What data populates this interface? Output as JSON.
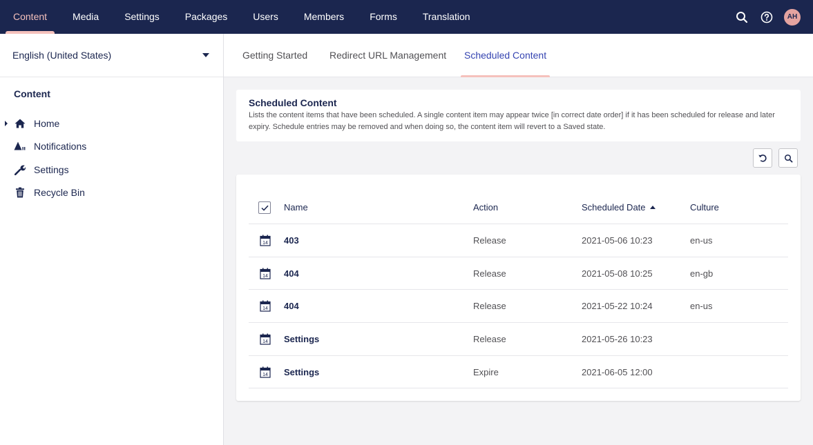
{
  "topnav": {
    "items": [
      {
        "label": "Content",
        "active": true
      },
      {
        "label": "Media"
      },
      {
        "label": "Settings"
      },
      {
        "label": "Packages"
      },
      {
        "label": "Users"
      },
      {
        "label": "Members"
      },
      {
        "label": "Forms"
      },
      {
        "label": "Translation"
      }
    ],
    "avatar_initials": "AH",
    "icons": [
      "search-icon",
      "help-icon"
    ]
  },
  "sidebar": {
    "language": "English (United States)",
    "title": "Content",
    "tree": [
      {
        "label": "Home",
        "icon": "home-icon"
      },
      {
        "label": "Notifications",
        "icon": "notifications-icon"
      },
      {
        "label": "Settings",
        "icon": "wrench-icon"
      },
      {
        "label": "Recycle Bin",
        "icon": "trash-icon"
      }
    ]
  },
  "tabs": [
    {
      "label": "Getting Started"
    },
    {
      "label": "Redirect URL Management"
    },
    {
      "label": "Scheduled Content",
      "active": true
    }
  ],
  "info": {
    "title": "Scheduled Content",
    "description": "Lists the content items that have been scheduled. A single content item may appear twice [in correct date order] if it has been scheduled for release and later expiry. Schedule entries may be removed and when doing so, the content item will revert to a Saved state."
  },
  "table": {
    "headers": {
      "name": "Name",
      "action": "Action",
      "date": "Scheduled Date",
      "culture": "Culture"
    },
    "rows": [
      {
        "name": "403",
        "action": "Release",
        "date": "2021-05-06 10:23",
        "culture": "en-us"
      },
      {
        "name": "404",
        "action": "Release",
        "date": "2021-05-08 10:25",
        "culture": "en-gb"
      },
      {
        "name": "404",
        "action": "Release",
        "date": "2021-05-22 10:24",
        "culture": "en-us"
      },
      {
        "name": "Settings",
        "action": "Release",
        "date": "2021-05-26 10:23",
        "culture": ""
      },
      {
        "name": "Settings",
        "action": "Expire",
        "date": "2021-06-05 12:00",
        "culture": ""
      }
    ],
    "row_icon": "calendar-icon",
    "calendar_day": "14"
  },
  "colors": {
    "nav_bg": "#1b264f",
    "accent": "#f5c1bc",
    "active_tab_text": "#3544b1",
    "avatar_bg": "#e4a3a0"
  }
}
